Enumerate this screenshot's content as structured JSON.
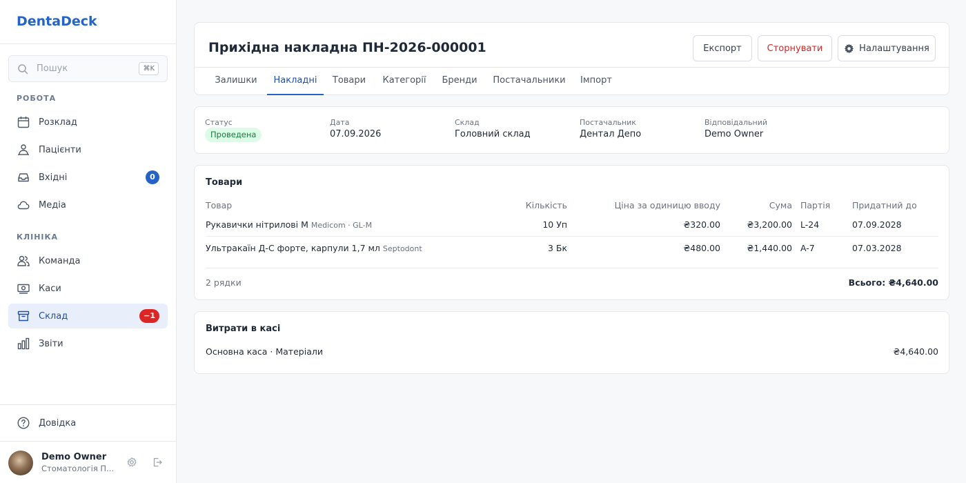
{
  "app": {
    "name": "DentaDeck"
  },
  "search": {
    "placeholder": "Пошук",
    "shortcut": "⌘K"
  },
  "sidebar": {
    "sections": [
      {
        "label": "РОБОТА"
      },
      {
        "label": "КЛІНІКА"
      }
    ],
    "items": [
      {
        "label": "Розклад",
        "icon": "calendar-icon"
      },
      {
        "label": "Пацієнти",
        "icon": "patients-icon"
      },
      {
        "label": "Вхідні",
        "icon": "inbox-icon",
        "badge": "0"
      },
      {
        "label": "Медіа",
        "icon": "cloud-icon"
      },
      {
        "label": "Команда",
        "icon": "team-icon"
      },
      {
        "label": "Каси",
        "icon": "cash-icon"
      },
      {
        "label": "Склад",
        "icon": "archive-icon",
        "badge": "−1",
        "active": true
      },
      {
        "label": "Звіти",
        "icon": "chart-icon"
      }
    ],
    "help": {
      "label": "Довідка"
    },
    "user": {
      "name": "Demo Owner",
      "org": "Стоматологія П..."
    }
  },
  "header": {
    "title": "Прихідна накладна ПН-2026-000001",
    "export_label": "Експорт",
    "reverse_label": "Сторнувати",
    "settings_label": "Налаштування"
  },
  "tabs": [
    {
      "label": "Залишки"
    },
    {
      "label": "Накладні",
      "active": true
    },
    {
      "label": "Товари"
    },
    {
      "label": "Категорії"
    },
    {
      "label": "Бренди"
    },
    {
      "label": "Постачальники"
    },
    {
      "label": "Імпорт"
    }
  ],
  "info": {
    "status_label": "Статус",
    "status_value": "Проведена",
    "date_label": "Дата",
    "date_value": "07.09.2026",
    "warehouse_label": "Склад",
    "warehouse_value": "Головний склад",
    "supplier_label": "Постачальник",
    "supplier_value": "Дентал Депо",
    "responsible_label": "Відповідальний",
    "responsible_value": "Demo Owner"
  },
  "items": {
    "title": "Товари",
    "columns": [
      "Товар",
      "Кількість",
      "Ціна за одиницю вводу",
      "Сума",
      "Партія",
      "Придатний до"
    ],
    "rows": [
      {
        "name": "Рукавички нітрилові M",
        "meta": "Medicom · GL-M",
        "qty": "10 Уп",
        "price": "₴320.00",
        "sum": "₴3,200.00",
        "batch": "L-24",
        "expiry": "07.09.2028"
      },
      {
        "name": "Ультракаїн Д-С форте, карпули 1,7 мл",
        "meta": "Septodont",
        "qty": "3 Бк",
        "price": "₴480.00",
        "sum": "₴1,440.00",
        "batch": "A-7",
        "expiry": "07.03.2028"
      }
    ],
    "count_label": "2 рядки",
    "total_label": "Всього: ₴4,640.00"
  },
  "expenses": {
    "title": "Витрати в касі",
    "line": "Основна каса · Матеріали",
    "amount": "₴4,640.00"
  },
  "colors": {
    "accent": "#2563c9",
    "danger": "#dc2626",
    "success_bg": "#dcfce7",
    "success_text": "#15803d"
  }
}
